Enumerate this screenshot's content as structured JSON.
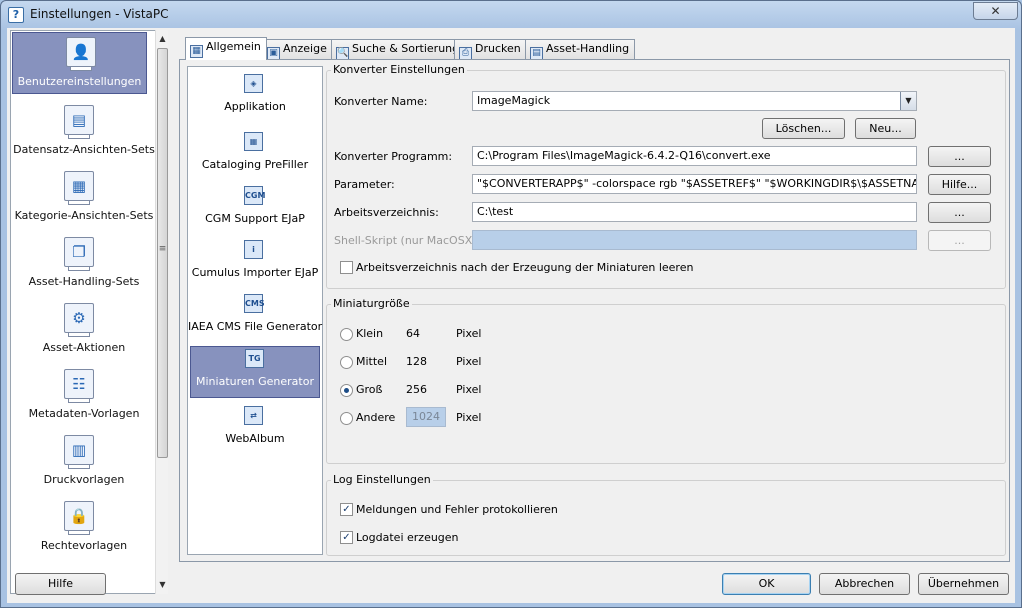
{
  "window": {
    "title": "Einstellungen - VistaPC",
    "close_symbol": "✕"
  },
  "nav": {
    "items": [
      {
        "label": "Benutzereinstellungen",
        "icon": "user-icon",
        "glyph": "👤"
      },
      {
        "label": "Datensatz-Ansichten-Sets",
        "icon": "record-views-icon",
        "glyph": "▤"
      },
      {
        "label": "Kategorie-Ansichten-Sets",
        "icon": "category-views-icon",
        "glyph": "▦"
      },
      {
        "label": "Asset-Handling-Sets",
        "icon": "asset-handling-icon",
        "glyph": "❐"
      },
      {
        "label": "Asset-Aktionen",
        "icon": "gears-icon",
        "glyph": "⚙"
      },
      {
        "label": "Metadaten-Vorlagen",
        "icon": "metadata-template-icon",
        "glyph": "☷"
      },
      {
        "label": "Druckvorlagen",
        "icon": "print-template-icon",
        "glyph": "▥"
      },
      {
        "label": "Rechtevorlagen",
        "icon": "lock-icon",
        "glyph": "🔒"
      }
    ],
    "scroll_up": "▲",
    "scroll_down": "▼",
    "grip": "≡"
  },
  "tabs": [
    {
      "label": "Allgemein",
      "icon": "general-icon",
      "glyph": "▦"
    },
    {
      "label": "Anzeige",
      "icon": "monitor-icon",
      "glyph": "▣"
    },
    {
      "label": "Suche & Sortierung",
      "icon": "search-icon",
      "glyph": "🔍"
    },
    {
      "label": "Drucken",
      "icon": "printer-icon",
      "glyph": "⎙"
    },
    {
      "label": "Asset-Handling",
      "icon": "asset-icon",
      "glyph": "▤"
    }
  ],
  "plugins": [
    {
      "label": "Applikation",
      "glyph": "◈"
    },
    {
      "label": "Cataloging PreFiller",
      "glyph": "▦"
    },
    {
      "label": "CGM Support EJaP",
      "glyph": "CGM"
    },
    {
      "label": "Cumulus Importer EJaP",
      "glyph": "i"
    },
    {
      "label": "IAEA CMS File Generator",
      "glyph": "CMS"
    },
    {
      "label": "Miniaturen Generator",
      "glyph": "TG"
    },
    {
      "label": "WebAlbum",
      "glyph": "⇄"
    }
  ],
  "converter": {
    "group_title": "Konverter Einstellungen",
    "name_label": "Konverter Name:",
    "name_value": "ImageMagick",
    "combo_arrow": "▼",
    "delete_btn": "Löschen...",
    "new_btn": "Neu...",
    "program_label": "Konverter Programm:",
    "program_value": "C:\\Program Files\\ImageMagick-6.4.2-Q16\\convert.exe",
    "program_browse": "...",
    "params_label": "Parameter:",
    "params_value": "\"$CONVERTERAPP$\" -colorspace rgb  \"$ASSETREF$\" \"$WORKINGDIR$\\$ASSETNAME.jpg$\"",
    "params_help": "Hilfe...",
    "workdir_label": "Arbeitsverzeichnis:",
    "workdir_value": "C:\\test",
    "workdir_browse": "...",
    "shell_label": "Shell-Skript (nur MacOSX):",
    "shell_value": "",
    "shell_browse": "...",
    "clear_label": "Arbeitsverzeichnis nach der Erzeugung der Miniaturen leeren",
    "clear_checked": false
  },
  "thumbsize": {
    "group_title": "Miniaturgröße",
    "options": [
      {
        "label": "Klein",
        "value": "64",
        "unit": "Pixel",
        "selected": false
      },
      {
        "label": "Mittel",
        "value": "128",
        "unit": "Pixel",
        "selected": false
      },
      {
        "label": "Groß",
        "value": "256",
        "unit": "Pixel",
        "selected": true
      },
      {
        "label": "Andere",
        "value": "1024",
        "unit": "Pixel",
        "selected": false
      }
    ]
  },
  "log": {
    "group_title": "Log Einstellungen",
    "errors_label": "Meldungen und Fehler protokollieren",
    "errors_checked": true,
    "logfile_label": "Logdatei erzeugen",
    "logfile_checked": true,
    "check_glyph": "✓"
  },
  "footer": {
    "help": "Hilfe",
    "ok": "OK",
    "cancel": "Abbrechen",
    "apply": "Übernehmen"
  }
}
